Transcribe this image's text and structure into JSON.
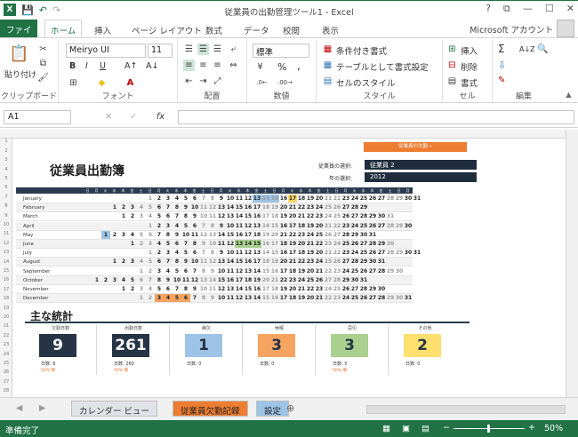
{
  "window": {
    "title": "従業員の出勤管理ツール1 - Excel"
  },
  "qat": {
    "save": "💾",
    "undo": "↶",
    "redo": "↷"
  },
  "window_buttons": {
    "help": "?",
    "restore": "⧉",
    "minimize": "—",
    "maximize": "☐",
    "close": "✕"
  },
  "ribbon_tabs": {
    "file": "ファイル",
    "home": "ホーム",
    "insert": "挿入",
    "page_layout": "ページ レイアウト",
    "formulas": "数式",
    "data": "データ",
    "review": "校閲",
    "view": "表示"
  },
  "account": "Microsoft アカウント",
  "ribbon": {
    "clipboard": {
      "paste": "貼り付け",
      "label": "クリップボード"
    },
    "font": {
      "name": "Meiryo UI",
      "size": "11",
      "bold": "B",
      "italic": "I",
      "underline": "U",
      "grow": "A↑",
      "shrink": "A↓",
      "label": "フォント"
    },
    "alignment": {
      "label": "配置"
    },
    "number": {
      "format": "標準",
      "percent": "%",
      "comma": ",",
      "label": "数値"
    },
    "styles": {
      "conditional": "条件付き書式",
      "table": "テーブルとして書式設定",
      "cell_styles": "セルのスタイル",
      "label": "スタイル"
    },
    "cells": {
      "insert": "挿入",
      "delete": "削除",
      "format": "書式",
      "label": "セル"
    },
    "editing": {
      "sum": "Σ",
      "fill": "⇩",
      "clear": "✎",
      "sort": "A↓Z",
      "find": "🔍",
      "label": "編集"
    }
  },
  "formula_bar": {
    "name_box": "A1",
    "cancel": "✕",
    "enter": "✓",
    "fx": "fx",
    "value": ""
  },
  "sheet": {
    "title": "従業員出勤簿",
    "employee_label": "従業員の選択:",
    "employee_value": "従業員 2",
    "year_label": "年の選択:",
    "year_value": "2012",
    "absence_button": "従業員の欠勤 »",
    "weekday_headers": [
      "日",
      "月",
      "火",
      "水",
      "木",
      "金",
      "土",
      "日",
      "月",
      "火",
      "水",
      "木",
      "金",
      "土",
      "日",
      "月",
      "火",
      "水",
      "木",
      "金",
      "土",
      "日",
      "月",
      "火",
      "水",
      "木",
      "金",
      "土",
      "日",
      "月",
      "火",
      "水",
      "木",
      "金",
      "土",
      "日",
      "月"
    ],
    "months": [
      {
        "name": "January",
        "start": 7,
        "days": 31
      },
      {
        "name": "February",
        "start": 3,
        "days": 29
      },
      {
        "name": "March",
        "start": 4,
        "days": 31
      },
      {
        "name": "April",
        "start": 7,
        "days": 30
      },
      {
        "name": "May",
        "start": 2,
        "days": 31
      },
      {
        "name": "June",
        "start": 5,
        "days": 30
      },
      {
        "name": "July",
        "start": 7,
        "days": 31
      },
      {
        "name": "August",
        "start": 3,
        "days": 31
      },
      {
        "name": "September",
        "start": 6,
        "days": 30
      },
      {
        "name": "October",
        "start": 1,
        "days": 31
      },
      {
        "name": "November",
        "start": 4,
        "days": 30
      },
      {
        "name": "December",
        "start": 6,
        "days": 31
      }
    ],
    "highlights": [
      {
        "month": "January",
        "days": [
          13,
          14,
          15
        ],
        "color": "#9dc3e6"
      },
      {
        "month": "January",
        "days": [
          17
        ],
        "color": "#ffd966"
      },
      {
        "month": "May",
        "days": [
          1
        ],
        "color": "#9dc3e6"
      },
      {
        "month": "June",
        "days": [
          13,
          14,
          15
        ],
        "color": "#a9d08e"
      },
      {
        "month": "December",
        "days": [
          3,
          4,
          5,
          6
        ],
        "color": "#f4a460"
      }
    ]
  },
  "stats": {
    "title": "主な統計",
    "items": [
      {
        "caption": "欠勤日数",
        "value": "9",
        "sub": "日数: 6",
        "pct": "50% 増",
        "bg": "#263445",
        "fg": "#ffffff"
      },
      {
        "caption": "出勤日数",
        "value": "261",
        "sub": "日数: 260",
        "pct": "50% 増",
        "bg": "#263445",
        "fg": "#ffffff"
      },
      {
        "caption": "病欠",
        "value": "1",
        "sub": "日数: 0",
        "pct": "",
        "bg": "#9dc3e6",
        "fg": "#263445"
      },
      {
        "caption": "休暇",
        "value": "3",
        "sub": "日数: 0",
        "pct": "",
        "bg": "#f4a460",
        "fg": "#263445"
      },
      {
        "caption": "忌引",
        "value": "3",
        "sub": "日数: 5",
        "pct": "50% 増",
        "bg": "#a9d08e",
        "fg": "#263445"
      },
      {
        "caption": "その他",
        "value": "2",
        "sub": "日数: 0",
        "pct": "",
        "bg": "#ffe06e",
        "fg": "#263445"
      }
    ]
  },
  "sheet_tabs": [
    {
      "label": "カレンダー ビュー",
      "bg": "#dfe3e8",
      "fg": "#333333"
    },
    {
      "label": "従業員欠勤記録",
      "bg": "#ed7d31",
      "fg": "#222222"
    },
    {
      "label": "設定",
      "bg": "#9dc3e6",
      "fg": "#222222"
    }
  ],
  "add_sheet": "⊕",
  "status": {
    "ready": "準備完了",
    "zoom": "50%",
    "zoom_minus": "−",
    "zoom_plus": "+"
  },
  "colors": {
    "excel_green": "#217346",
    "navy": "#1f2d3d",
    "orange": "#ed7d31"
  }
}
